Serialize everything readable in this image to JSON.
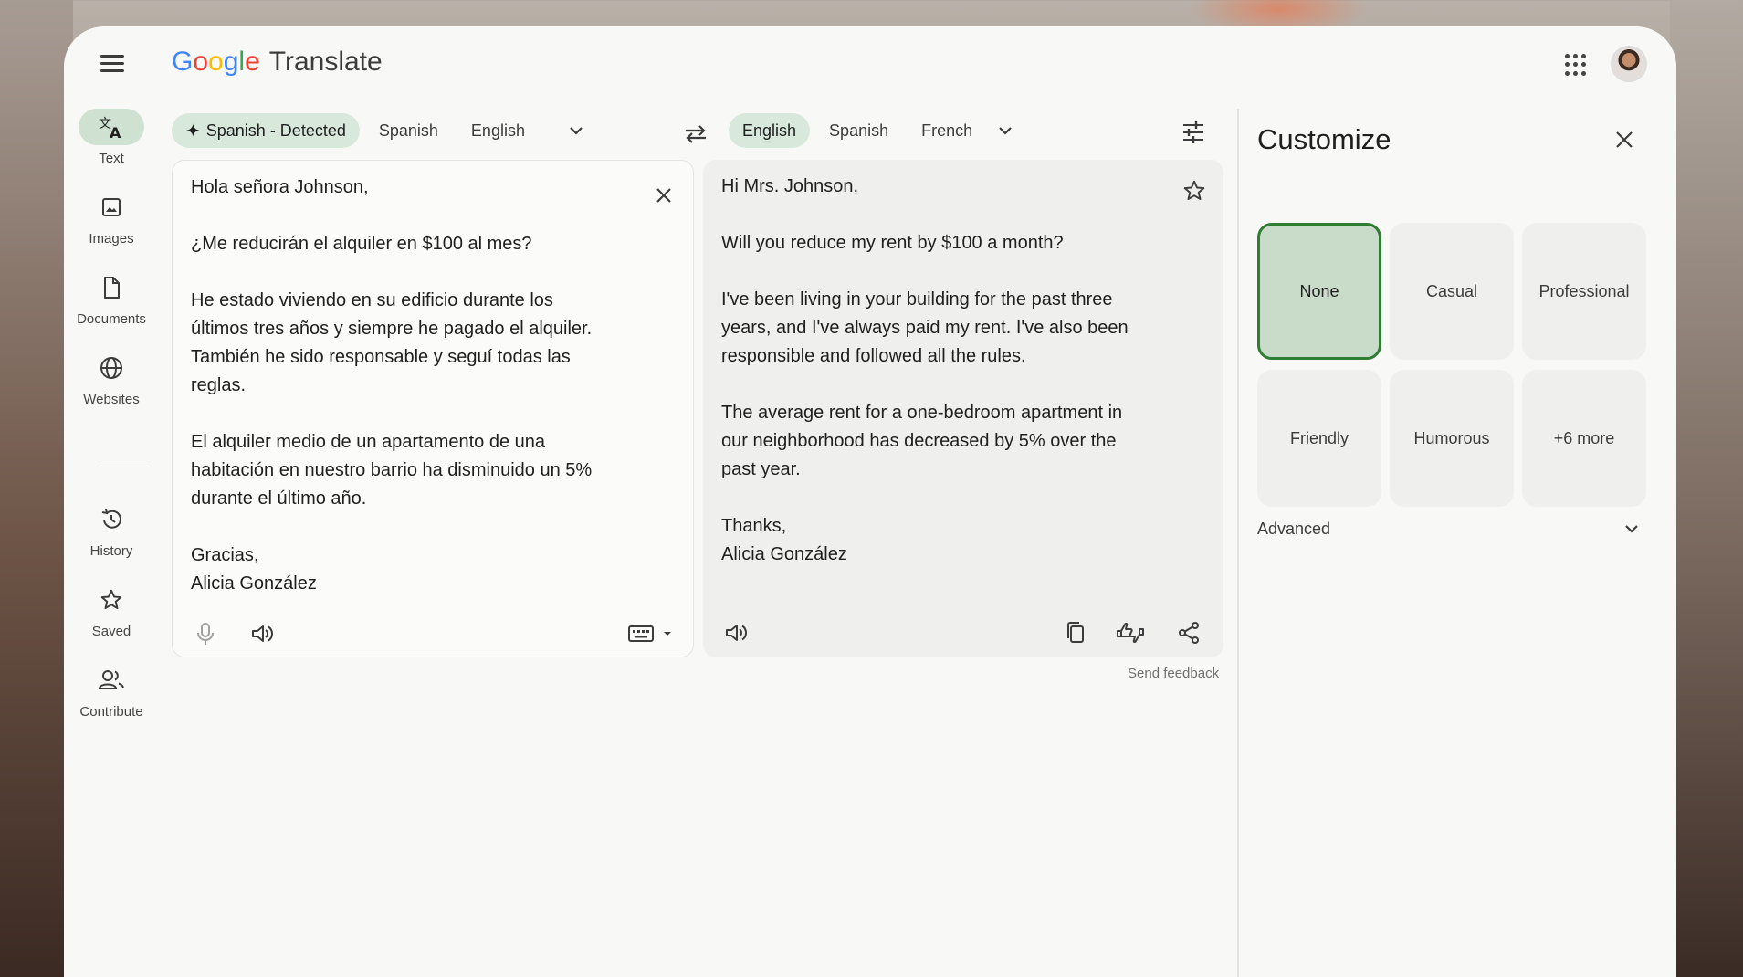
{
  "header": {
    "logo_letters": [
      "G",
      "o",
      "o",
      "g",
      "l",
      "e"
    ],
    "product_name": "Translate"
  },
  "rail": {
    "items": [
      {
        "label": "Text",
        "icon": "translate-icon",
        "active": true
      },
      {
        "label": "Images",
        "icon": "image-icon"
      },
      {
        "label": "Documents",
        "icon": "document-icon"
      },
      {
        "label": "Websites",
        "icon": "globe-icon"
      },
      {
        "label": "History",
        "icon": "history-icon"
      },
      {
        "label": "Saved",
        "icon": "star-icon"
      },
      {
        "label": "Contribute",
        "icon": "people-icon"
      }
    ]
  },
  "source_langs": {
    "detected": "Spanish - Detected",
    "options": [
      "Spanish",
      "English"
    ]
  },
  "target_langs": {
    "selected": "English",
    "options": [
      "Spanish",
      "French"
    ]
  },
  "source": {
    "text": "Hola señora Johnson,\n\n¿Me reducirán el alquiler en $100 al mes?\n\nHe estado viviendo en su edificio durante los\núltimos tres años y siempre he pagado el alquiler.\nTambién he sido responsable y seguí todas las\nreglas.\n\nEl alquiler medio de un apartamento de una\nhabitación en nuestro barrio ha disminuido un 5%\ndurante el último año.\n\nGracias,\nAlicia González"
  },
  "target": {
    "text": "Hi Mrs. Johnson,\n\nWill you reduce my rent by $100 a month?\n\nI've been living in your building for the past three\nyears, and I've always paid my rent. I've also been\nresponsible and followed all the rules.\n\nThe average rent for a one-bedroom apartment in\nour neighborhood has decreased by 5% over the\npast year.\n\nThanks,\nAlicia González"
  },
  "send_feedback": "Send feedback",
  "customize": {
    "title": "Customize",
    "tones": [
      "None",
      "Casual",
      "Professional",
      "Friendly",
      "Humorous",
      "+6 more"
    ],
    "selected_tone": "None",
    "advanced_label": "Advanced"
  },
  "colors": {
    "accent_green": "#2e7d32",
    "selected_chip": "#d8e8db"
  }
}
